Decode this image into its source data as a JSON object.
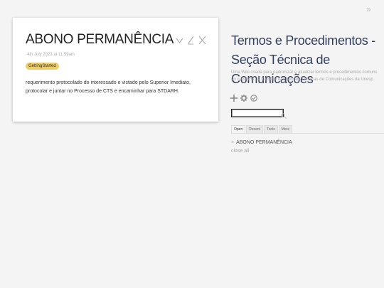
{
  "story": {
    "tiddler": {
      "title": "ABONO PERMANÊNCIA",
      "subtitle": "4th July 2023 at 11:59am",
      "tag": "GettingStarted",
      "body": "requerimento protocolado do interessado e vistado pelo Superior Imediato, protocolar e juntar no Processo de CTS e encaminhar para STDARH.",
      "controls": [
        "chevron-down-icon",
        "edit-icon",
        "close-icon"
      ]
    }
  },
  "sidebar": {
    "title": "Termos e Procedimentos - Seção Técnica de Comunicações",
    "subtitle": "Uma Wiki criada para padronizar e atualizar termos e procedimentos comuns ao cotidiano de trabalho das Seções Técnicas de Comunicações da Unesp",
    "page_controls": [
      "plus-icon",
      "gear-icon",
      "check-circle-icon"
    ],
    "search": {
      "value": ""
    },
    "tabs": [
      {
        "label": "Open",
        "active": true
      },
      {
        "label": "Recent",
        "active": false
      },
      {
        "label": "Tools",
        "active": false
      },
      {
        "label": "More",
        "active": false
      }
    ],
    "open_tiddlers": [
      "ABONO PERMANÊNCIA"
    ],
    "close_all": "close all"
  },
  "colors": {
    "background": "#f4f4f4",
    "tag_background": "#eecc66",
    "site_title": "#333e5c",
    "muted": "#aaaaaa"
  }
}
